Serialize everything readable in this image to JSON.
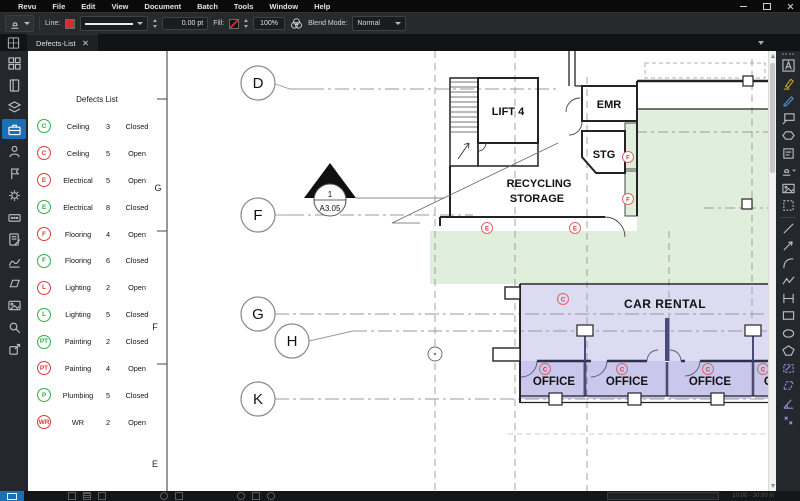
{
  "menubar": {
    "items": [
      "Revu",
      "File",
      "Edit",
      "View",
      "Document",
      "Batch",
      "Tools",
      "Window",
      "Help"
    ]
  },
  "toolbar": {
    "line_label": "Line:",
    "width_value": "0.00 pt",
    "fill_label": "Fill:",
    "opacity_value": "100%",
    "blend_label": "Blend Mode:",
    "blend_value": "Normal"
  },
  "tabs": {
    "active": "Defects-List"
  },
  "defects": {
    "title": "Defects List",
    "rows": [
      {
        "code": "C",
        "color": "green",
        "name": "Ceiling",
        "count": "3",
        "status": "Closed"
      },
      {
        "code": "C",
        "color": "red",
        "name": "Ceiling",
        "count": "5",
        "status": "Open"
      },
      {
        "code": "E",
        "color": "red",
        "name": "Electrical",
        "count": "5",
        "status": "Open"
      },
      {
        "code": "E",
        "color": "green",
        "name": "Electrical",
        "count": "8",
        "status": "Closed"
      },
      {
        "code": "F",
        "color": "red",
        "name": "Flooring",
        "count": "4",
        "status": "Open"
      },
      {
        "code": "F",
        "color": "green",
        "name": "Flooring",
        "count": "6",
        "status": "Closed"
      },
      {
        "code": "L",
        "color": "red",
        "name": "Lighting",
        "count": "2",
        "status": "Open"
      },
      {
        "code": "L",
        "color": "green",
        "name": "Lighting",
        "count": "5",
        "status": "Closed"
      },
      {
        "code": "PT",
        "color": "green",
        "name": "Painting",
        "count": "2",
        "status": "Closed"
      },
      {
        "code": "PT",
        "color": "red",
        "name": "Painting",
        "count": "4",
        "status": "Open"
      },
      {
        "code": "P",
        "color": "green",
        "name": "Plumbing",
        "count": "5",
        "status": "Closed"
      },
      {
        "code": "WR",
        "color": "red",
        "name": "WR",
        "count": "2",
        "status": "Open"
      }
    ]
  },
  "plan": {
    "grid_bubbles": [
      "D",
      "F",
      "G",
      "H",
      "K"
    ],
    "row_letters": [
      "G",
      "F",
      "E"
    ],
    "section_marker": {
      "number": "1",
      "sheet": "A3.05"
    },
    "rooms": {
      "lift": "LIFT 4",
      "emr": "EMR",
      "stg": "STG",
      "recycling_line1": "RECYCLING",
      "recycling_line2": "STORAGE",
      "car_rental": "CAR RENTAL",
      "office": "OFFICE"
    },
    "markers": {
      "c": "C",
      "e": "E",
      "f": "F"
    }
  },
  "statusbar": {
    "page_info": "10:00 - 30.00 in"
  },
  "colors": {
    "accent_blue": "#1d6fb5",
    "legend_green": "#2cae48",
    "legend_red": "#df3b3b",
    "marker_red": "#d33a3a",
    "zone_green": "#e0efdc",
    "zone_lavender": "#dcdbf2",
    "zone_office": "#c9c8ec",
    "line_swatch_red": "#d03030"
  }
}
